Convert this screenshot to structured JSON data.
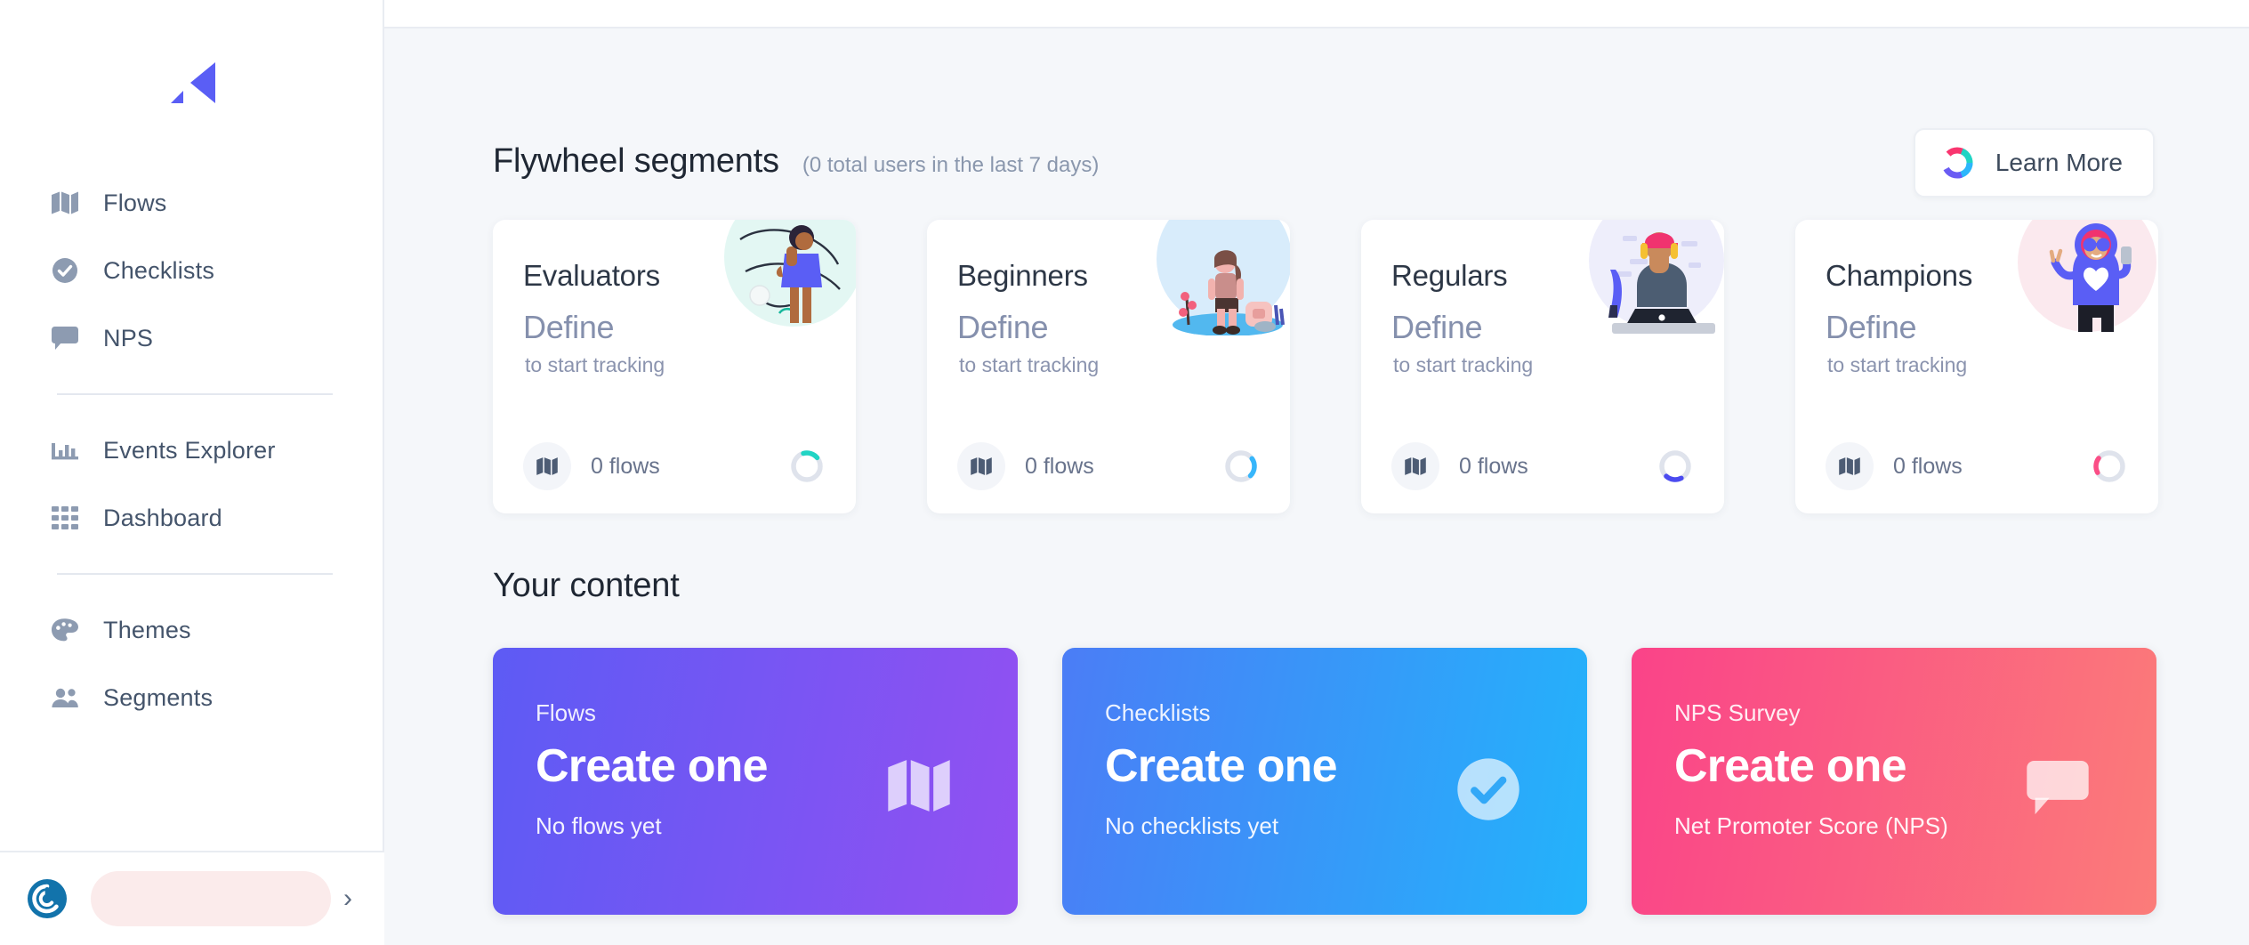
{
  "brand": {
    "logo_name": "flywheel-logo",
    "accent": "#5a5ef5"
  },
  "sidebar": {
    "groups": [
      {
        "items": [
          {
            "label": "Flows",
            "icon": "map-icon"
          },
          {
            "label": "Checklists",
            "icon": "check-circle-icon"
          },
          {
            "label": "NPS",
            "icon": "speech-bubble-icon"
          }
        ]
      },
      {
        "items": [
          {
            "label": "Events Explorer",
            "icon": "bar-chart-icon"
          },
          {
            "label": "Dashboard",
            "icon": "grid-icon"
          }
        ]
      },
      {
        "items": [
          {
            "label": "Themes",
            "icon": "palette-icon"
          },
          {
            "label": "Segments",
            "icon": "users-group-icon"
          }
        ]
      }
    ],
    "footer": {
      "avatar": "workspace-avatar",
      "name": "",
      "chevron": "›"
    }
  },
  "flywheel": {
    "title": "Flywheel segments",
    "subtitle": "(0 total users in the last 7 days)",
    "learn_more": {
      "label": "Learn More",
      "icon": "flywheel-donut-icon"
    },
    "segments": [
      {
        "name": "Evaluators",
        "action": "Define",
        "hint": "to start tracking",
        "flows": "0 flows",
        "donut_color": "#21d4c4",
        "donut_start": -90,
        "donut_sweep": 62,
        "illus_bg": "#e3f7f3",
        "illustration": "woman-thinking-illustration"
      },
      {
        "name": "Beginners",
        "action": "Define",
        "hint": "to start tracking",
        "flows": "0 flows",
        "donut_color": "#37b6fb",
        "donut_start": -20,
        "donut_sweep": 78,
        "illus_bg": "#d8ecfb",
        "illustration": "hiker-illustration"
      },
      {
        "name": "Regulars",
        "action": "Define",
        "hint": "to start tracking",
        "flows": "0 flows",
        "donut_color": "#4b4bf0",
        "donut_start": 58,
        "donut_sweep": 66,
        "illus_bg": "#eeeefb",
        "illustration": "person-laptop-illustration"
      },
      {
        "name": "Champions",
        "action": "Define",
        "hint": "to start tracking",
        "flows": "0 flows",
        "donut_color": "#fb4e86",
        "donut_start": 150,
        "donut_sweep": 62,
        "illus_bg": "#fbe9ee",
        "illustration": "person-peace-sign-illustration"
      }
    ]
  },
  "your_content": {
    "title": "Your content",
    "tiles": [
      {
        "kicker": "Flows",
        "cta": "Create one",
        "sub": "No flows yet",
        "icon": "map-icon",
        "grad_from": "#5d5bf4",
        "grad_to": "#9250f2"
      },
      {
        "kicker": "Checklists",
        "cta": "Create one",
        "sub": "No checklists yet",
        "icon": "check-circle-icon",
        "grad_from": "#4b7df6",
        "grad_to": "#23b3fb"
      },
      {
        "kicker": "NPS Survey",
        "cta": "Create one",
        "sub": "Net Promoter Score (NPS)",
        "icon": "speech-bubble-icon",
        "grad_from": "#fa4389",
        "grad_to": "#fb7c79"
      }
    ]
  }
}
